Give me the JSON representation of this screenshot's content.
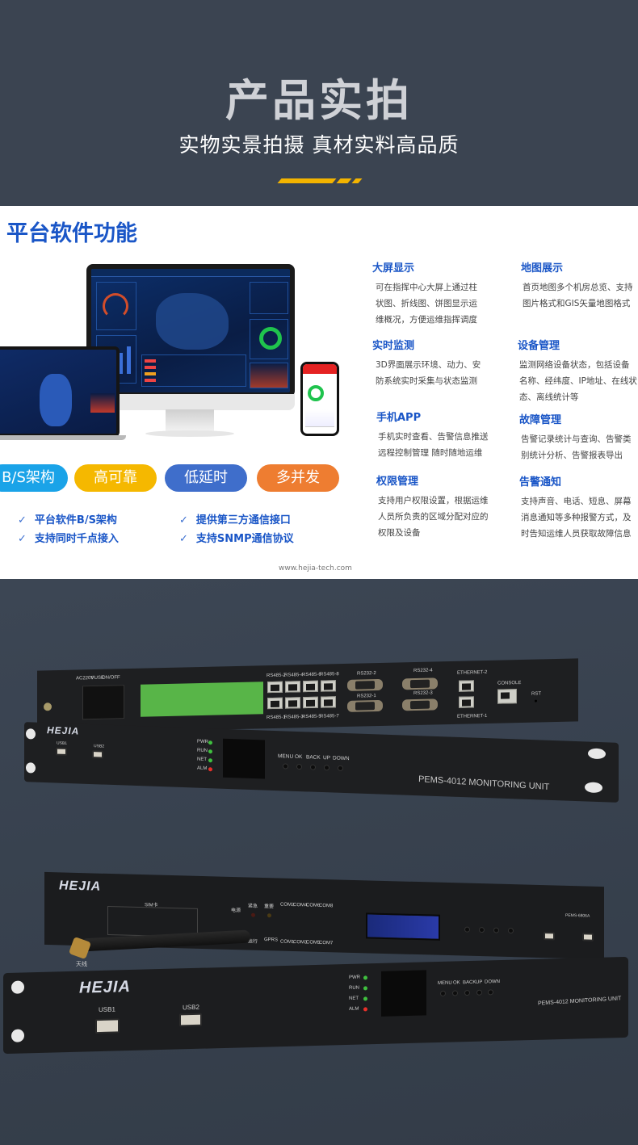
{
  "header": {
    "title": "产品实拍",
    "subtitle": "实物实景拍摄  真材实料高品质",
    "accent_color": "#f3b400"
  },
  "software": {
    "title": "平台软件功能",
    "title_color": "#1a56c7",
    "pills": [
      {
        "label": "B/S架构",
        "color": "#1aa3e8"
      },
      {
        "label": "高可靠",
        "color": "#f5b800"
      },
      {
        "label": "低延时",
        "color": "#3f6ecb"
      },
      {
        "label": "多并发",
        "color": "#ee7d31"
      }
    ],
    "checks": [
      "平台软件B/S架构",
      "提供第三方通信接口",
      "支持同时千点接入",
      "支持SNMP通信协议"
    ],
    "features": [
      {
        "title": "大屏显示",
        "desc": "可在指挥中心大屏上通过柱状图、折线图、饼图显示运维概况，方便运维指挥调度"
      },
      {
        "title": "地图展示",
        "desc": "首页地图多个机房总览、支持图片格式和GIS矢量地图格式"
      },
      {
        "title": "实时监测",
        "desc": "3D界面展示环境、动力、安防系统实时采集与状态监测"
      },
      {
        "title": "设备管理",
        "desc": "监测网络设备状态，包括设备名称、经纬度、IP地址、在线状态、离线统计等"
      },
      {
        "title": "手机APP",
        "desc": "手机实时查看、告警信息推送远程控制管理 随时随地运维"
      },
      {
        "title": "故障管理",
        "desc": "告警记录统计与查询、告警类别统计分析、告警报表导出"
      },
      {
        "title": "权限管理",
        "desc": "支持用户权限设置，根据运维人员所负责的区域分配对应的权限及设备"
      },
      {
        "title": "告警通知",
        "desc": "支持声音、电话、短息、屏幕消息通知等多种报警方式，及时告知运维人员获取故障信息"
      }
    ],
    "url": "www.hejia-tech.com",
    "check_icon": "✓"
  },
  "device1_rear": {
    "power_labels": [
      "AC220V",
      "FUSE",
      "ON/OFF"
    ],
    "rs485_top": [
      "RS485-2",
      "RS485-4",
      "RS485-6",
      "RS485-8"
    ],
    "rs485_bottom": [
      "RS485-1",
      "RS485-3",
      "RS485-5",
      "RS485-7"
    ],
    "rs232_top": [
      "RS232-2",
      "RS232-4"
    ],
    "rs232_bottom": [
      "RS232-1",
      "RS232-3"
    ],
    "ethernet_top": "ETHERNET-2",
    "ethernet_bottom": "ETHERNET-1",
    "console": "CONSOLE",
    "rst": "RST"
  },
  "device1_front": {
    "logo": "HEJIA",
    "usb": [
      "USB1",
      "USB2"
    ],
    "leds": [
      {
        "label": "PWR",
        "color": "#3fbf3f"
      },
      {
        "label": "RUN",
        "color": "#3fbf3f"
      },
      {
        "label": "NET",
        "color": "#3fbf3f"
      },
      {
        "label": "ALM",
        "color": "#e8302a"
      }
    ],
    "buttons": [
      "MENU",
      "OK",
      "BACK",
      "UP",
      "DOWN"
    ],
    "model": "PEMS-4012 MONITORING UNIT"
  },
  "device2": {
    "logo": "HEJIA",
    "sim": "SIM卡",
    "antenna": "天线",
    "power": "电源",
    "status_top": [
      "紧急",
      "重要"
    ],
    "status_bottom": [
      "运行",
      "GPRS"
    ],
    "com_top": [
      "COM2",
      "COM4",
      "COM6",
      "COM8"
    ],
    "com_bottom": [
      "COM1",
      "COM3",
      "COM5",
      "COM7"
    ],
    "model": "PEMS-6806A"
  },
  "device3": {
    "logo": "HEJIA",
    "usb": [
      "USB1",
      "USB2"
    ],
    "leds": [
      {
        "label": "PWR",
        "color": "#3fbf3f"
      },
      {
        "label": "RUN",
        "color": "#3fbf3f"
      },
      {
        "label": "NET",
        "color": "#3fbf3f"
      },
      {
        "label": "ALM",
        "color": "#e8302a"
      }
    ],
    "buttons": [
      "MENU",
      "OK",
      "BACK",
      "UP",
      "DOWN"
    ],
    "model": "PEMS-4012 MONITORING UNIT"
  }
}
